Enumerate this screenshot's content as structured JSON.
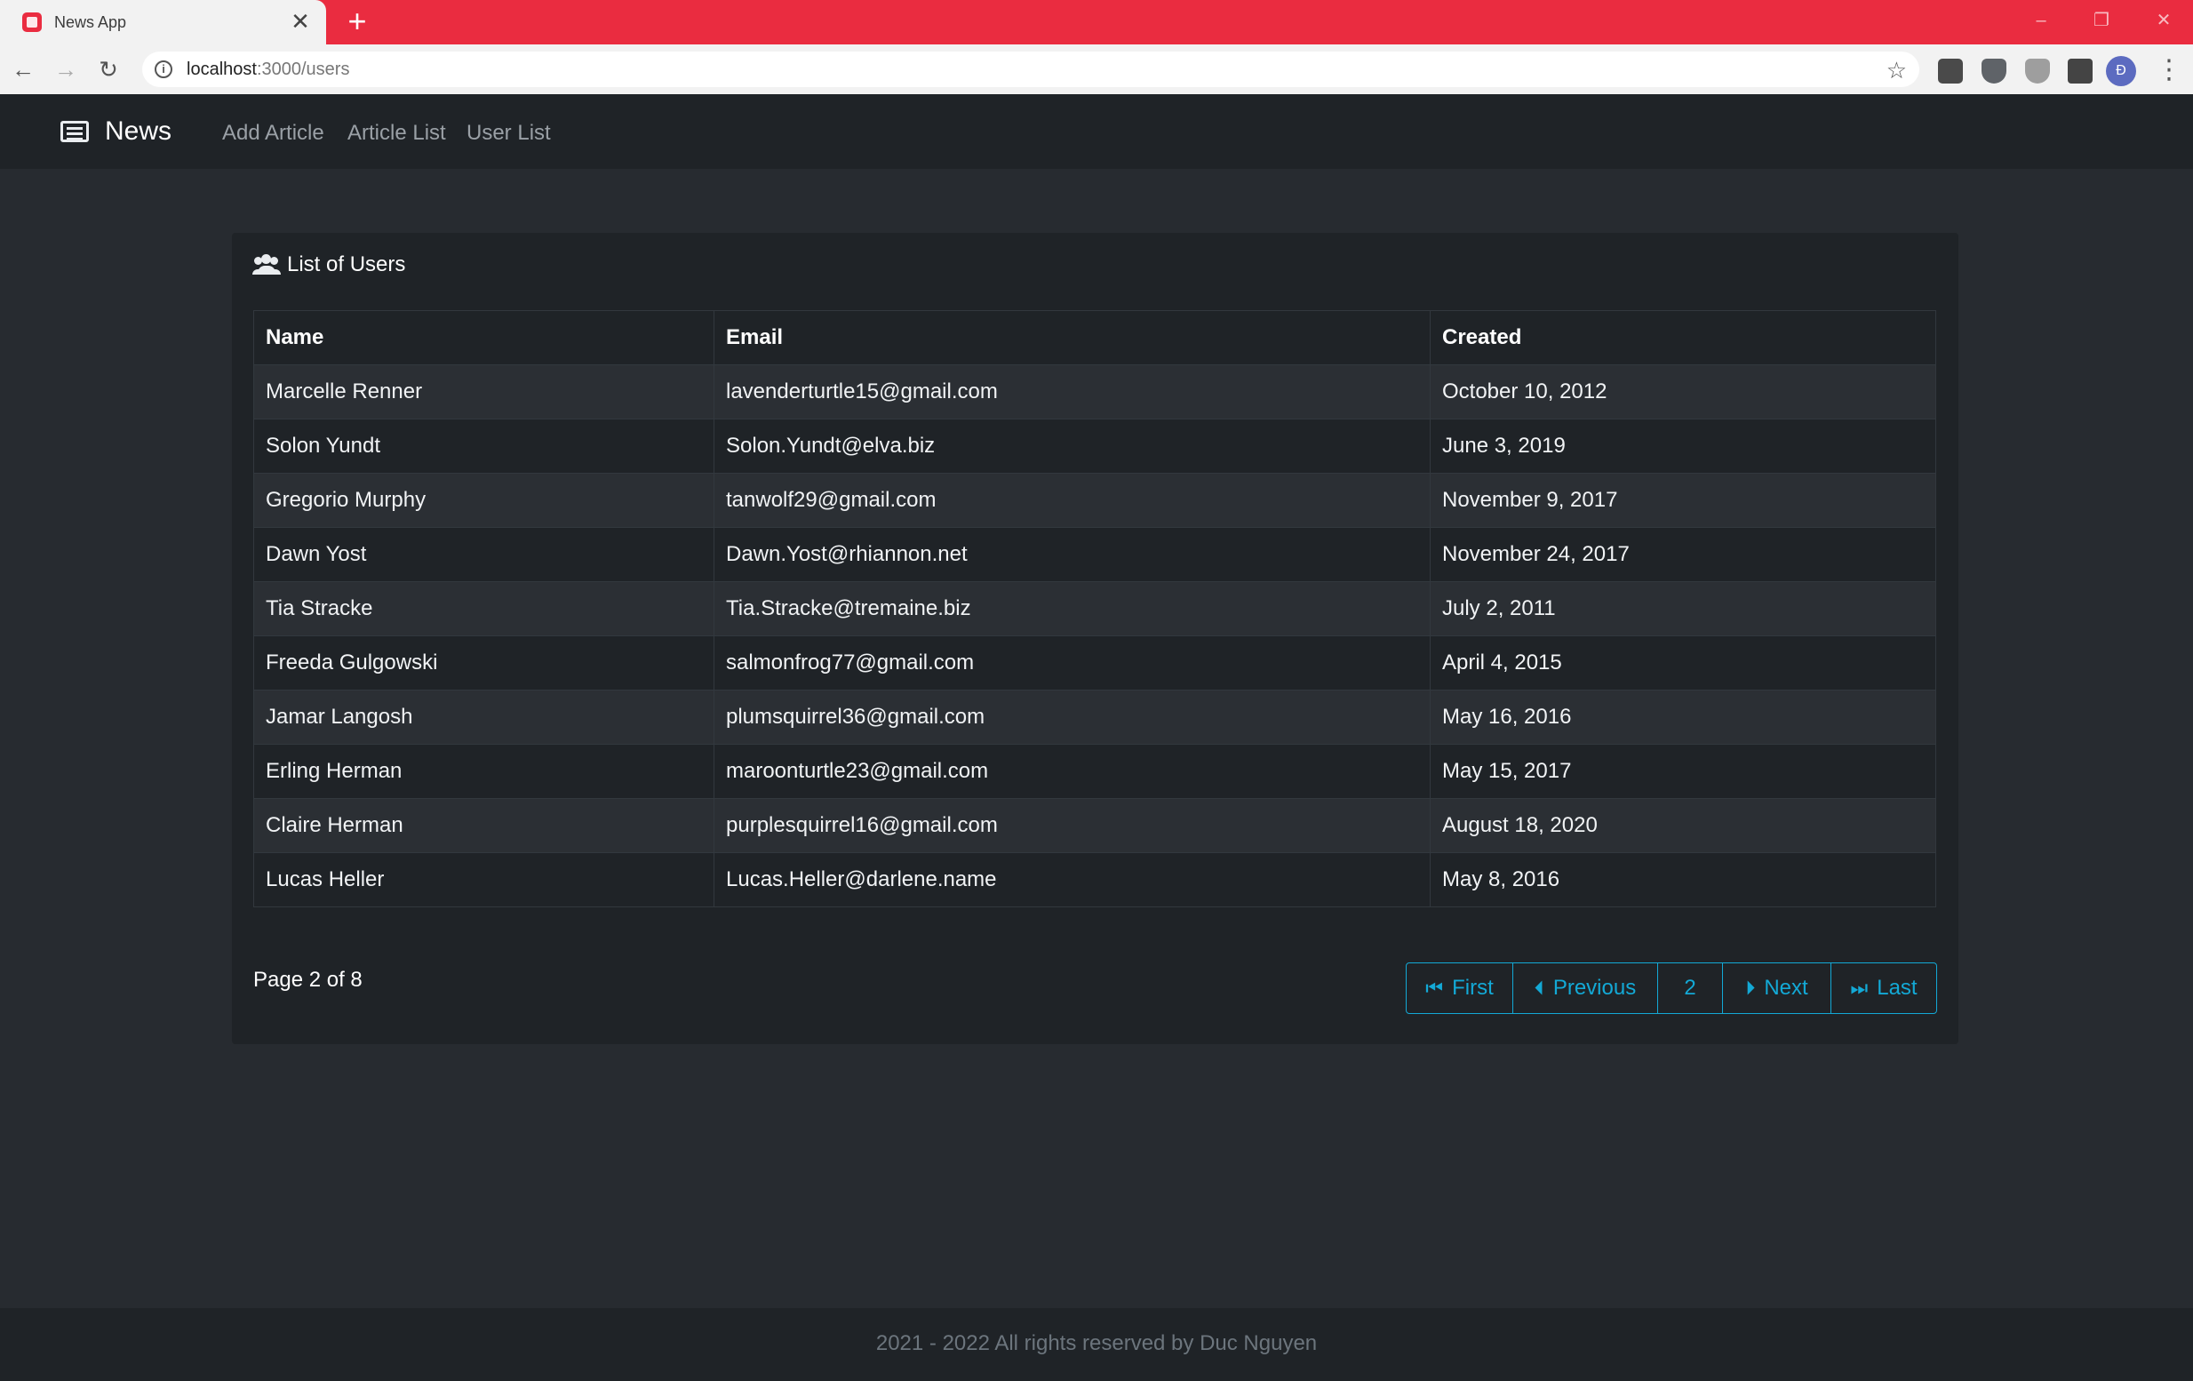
{
  "browser": {
    "tab_title": "News App",
    "tab_close": "✕",
    "new_tab": "+",
    "url_host": "localhost",
    "url_path": ":3000/users",
    "avatar_letter": "Đ"
  },
  "navbar": {
    "brand": "News",
    "links": [
      "Add Article",
      "Article List",
      "User List"
    ]
  },
  "card": {
    "title": "List of Users",
    "columns": [
      "Name",
      "Email",
      "Created"
    ],
    "rows": [
      [
        "Marcelle Renner",
        "lavenderturtle15@gmail.com",
        "October 10, 2012"
      ],
      [
        "Solon Yundt",
        "Solon.Yundt@elva.biz",
        "June 3, 2019"
      ],
      [
        "Gregorio Murphy",
        "tanwolf29@gmail.com",
        "November 9, 2017"
      ],
      [
        "Dawn Yost",
        "Dawn.Yost@rhiannon.net",
        "November 24, 2017"
      ],
      [
        "Tia Stracke",
        "Tia.Stracke@tremaine.biz",
        "July 2, 2011"
      ],
      [
        "Freeda Gulgowski",
        "salmonfrog77@gmail.com",
        "April 4, 2015"
      ],
      [
        "Jamar Langosh",
        "plumsquirrel36@gmail.com",
        "May 16, 2016"
      ],
      [
        "Erling Herman",
        "maroonturtle23@gmail.com",
        "May 15, 2017"
      ],
      [
        "Claire Herman",
        "purplesquirrel16@gmail.com",
        "August 18, 2020"
      ],
      [
        "Lucas Heller",
        "Lucas.Heller@darlene.name",
        "May 8, 2016"
      ]
    ],
    "page_info": "Page 2 of 8",
    "pagination": {
      "first": "First",
      "previous": "Previous",
      "current": "2",
      "next": "Next",
      "last": "Last"
    }
  },
  "footer": {
    "text": "2021 - 2022 All rights reserved by Duc Nguyen"
  },
  "colors": {
    "tabbar": "#ea2c40",
    "page_bg": "#272b30",
    "panel_bg": "#1f2327",
    "accent": "#13a9d6"
  }
}
